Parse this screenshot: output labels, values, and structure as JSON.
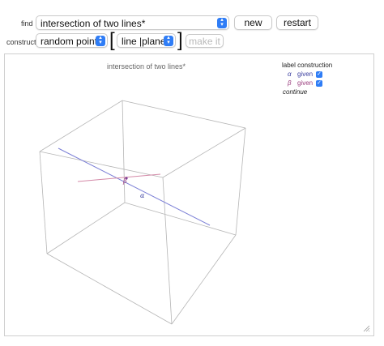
{
  "controls": {
    "find_label": "find",
    "find_value": "intersection of two lines*",
    "new_label": "new",
    "restart_label": "restart",
    "construct_label": "construct",
    "construct_value": "random point",
    "bracket_open": "[",
    "bracket_close": "]",
    "type_option_a": "line",
    "type_separator": "|",
    "type_option_b": "plane",
    "make_it_label": "make it"
  },
  "plot": {
    "title": "intersection of two lines*",
    "label_alpha": "α",
    "label_beta": "β"
  },
  "legend": {
    "header": "label construction",
    "items": [
      {
        "symbol": "α",
        "text": "given",
        "color": "#3b3fa0",
        "checked": true
      },
      {
        "symbol": "β",
        "text": "given",
        "color": "#9b3f7f",
        "checked": true
      }
    ],
    "continue_label": "continue"
  },
  "colors": {
    "accent": "#2f7df6",
    "line_alpha": "#7b7fd6",
    "line_beta": "#d48aa8",
    "box_edges": "#b5b5b5"
  }
}
